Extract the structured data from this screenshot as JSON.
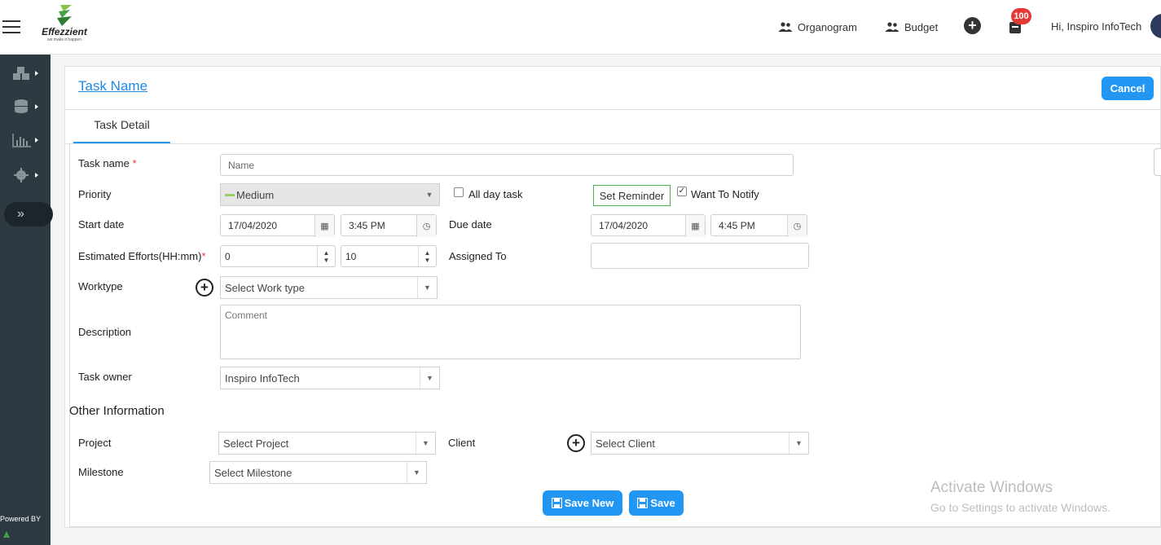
{
  "header": {
    "app_name": "Effezzient",
    "tagline": "we make it happen",
    "links": {
      "organogram": "Organogram",
      "budget": "Budget"
    },
    "notification_count": "100",
    "greeting": "Hi, Inspiro InfoTech"
  },
  "sidebar": {
    "items": [
      {
        "icon": "cubes-icon"
      },
      {
        "icon": "database-icon"
      },
      {
        "icon": "chart-icon"
      },
      {
        "icon": "gear-icon"
      }
    ],
    "expand_glyph": "»",
    "powered_by": "Powered BY"
  },
  "page": {
    "title": "Task Name",
    "cancel_label": "Cancel",
    "tab_label": "Task Detail"
  },
  "form": {
    "task_name_label": "Task name",
    "task_name_placeholder": "Name",
    "priority_label": "Priority",
    "priority_value": "Medium",
    "all_day_label": "All day task",
    "set_reminder_label": "Set Reminder",
    "want_notify_label": "Want To Notify",
    "start_date_label": "Start date",
    "start_date": "17/04/2020",
    "start_time": "3:45 PM",
    "due_date_label": "Due date",
    "due_date": "17/04/2020",
    "due_time": "4:45 PM",
    "efforts_label": "Estimated Efforts(HH:mm)",
    "efforts_hours": "0",
    "efforts_minutes": "10",
    "assigned_label": "Assigned To",
    "worktype_label": "Worktype",
    "worktype_placeholder": "Select Work type",
    "description_label": "Description",
    "comment_placeholder": "Comment",
    "owner_label": "Task owner",
    "owner_value": "Inspiro InfoTech"
  },
  "other": {
    "section_title": "Other Information",
    "project_label": "Project",
    "project_placeholder": "Select Project",
    "client_label": "Client",
    "client_placeholder": "Select Client",
    "milestone_label": "Milestone",
    "milestone_placeholder": "Select Milestone"
  },
  "actions": {
    "save_new_label": "Save New",
    "save_label": "Save"
  },
  "watermark": {
    "line1": "Activate Windows",
    "line2": "Go to Settings to activate Windows."
  },
  "colors": {
    "accent": "#2196f3",
    "sidebar": "#2e3a42",
    "badge": "#e53935",
    "link": "#1e88e5"
  }
}
